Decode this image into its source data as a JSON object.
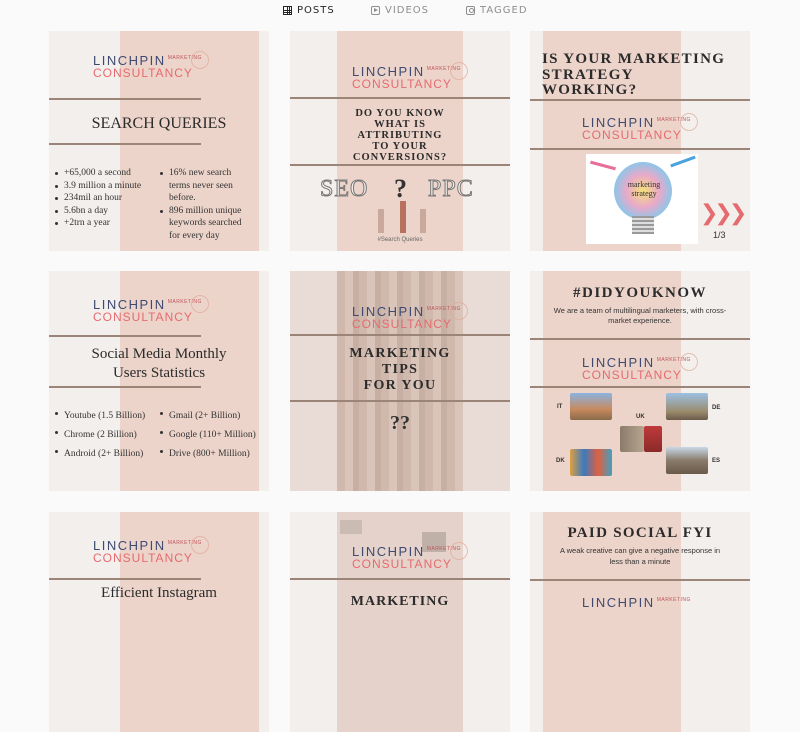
{
  "tabs": [
    {
      "label": "POSTS",
      "icon": "grid-icon",
      "active": true
    },
    {
      "label": "VIDEOS",
      "icon": "video-icon",
      "active": false
    },
    {
      "label": "TAGGED",
      "icon": "tag-icon",
      "active": false
    }
  ],
  "brand": {
    "line1": "LINCHPIN",
    "sup": "MARKETING",
    "line2": "CONSULTANCY"
  },
  "posts": {
    "p1": {
      "title": "SEARCH QUERIES",
      "left_list": [
        "+65,000 a second",
        "3.9 million a minute",
        "234mil an hour",
        "5.6bn a day",
        "+2trn a year"
      ],
      "right_list": [
        "16% new search",
        "terms never seen",
        "before.",
        "896 million unique",
        "keywords searched",
        "for every day"
      ]
    },
    "p2": {
      "title_lines": [
        "DO YOU KNOW",
        "WHAT IS",
        "ATTRIBUTING",
        "TO YOUR",
        "CONVERSIONS?"
      ],
      "seo": "SEO",
      "q": "?",
      "ppc": "PPC",
      "footer": "#Search Queries"
    },
    "p3": {
      "title_lines": [
        "IS YOUR MARKETING",
        "STRATEGY",
        "WORKING?"
      ],
      "bulb_text": "marketing strategy",
      "page": "1/3"
    },
    "p4": {
      "title_lines": [
        "Social Media Monthly",
        "Users Statistics"
      ],
      "left_list": [
        "Youtube (1.5 Billion)",
        "Chrome (2 Billion)",
        "Android (2+ Billion)"
      ],
      "right_list": [
        "Gmail (2+ Billion)",
        "Google (110+ Million)",
        "Drive (800+ Million)"
      ]
    },
    "p5": {
      "title_lines": [
        "MARKETING",
        "TIPS",
        "FOR YOU"
      ],
      "qq": "??"
    },
    "p6": {
      "title": "#DIDYOUKNOW",
      "subtitle_lines": [
        "We are a team of multilingual marketers, with cross-",
        "market experience."
      ],
      "countries": [
        "IT",
        "UK",
        "DE",
        "DK",
        "ES"
      ]
    },
    "p7": {
      "title": "Efficient Instagram"
    },
    "p8": {
      "title": "MARKETING"
    },
    "p9": {
      "title": "PAID SOCIAL FYI",
      "subtitle_lines": [
        "A weak creative can give a negative  response in",
        "less than a minute"
      ]
    }
  },
  "colors": {
    "navy": "#3e4a72",
    "coral": "#e56b6f",
    "pink": "#ecd4ca",
    "bg": "#f3efed",
    "rule": "#9b8579"
  }
}
